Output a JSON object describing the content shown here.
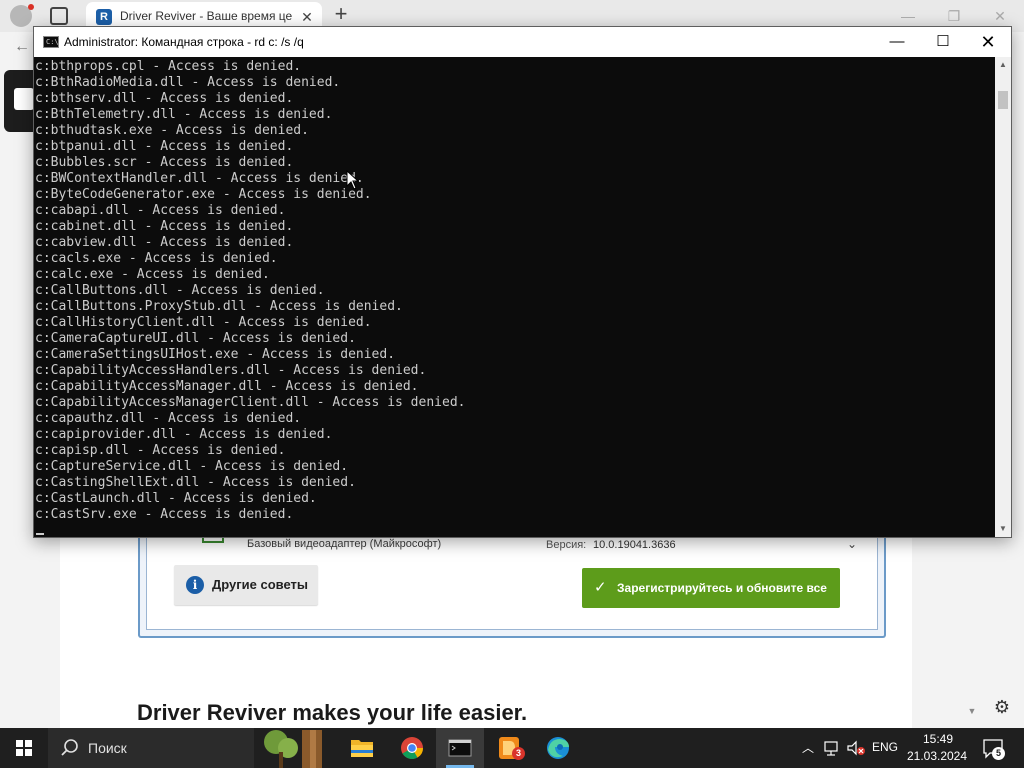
{
  "browser": {
    "tab_title": "Driver Reviver - Ваше время це",
    "tab_favicon_letter": "R"
  },
  "page": {
    "device_name": "Базовый видеоадаптер (Майкрософт)",
    "version_label": "Версия:",
    "version_value": "10.0.19041.3636",
    "tips_label": "Другие советы",
    "tips_icon": "i",
    "register_label": "Зарегистрируйтесь и обновите все",
    "heading": "Driver Reviver makes your life easier.",
    "colors": {
      "register": "#5d9c1b",
      "tips_icon": "#1b5ea7",
      "panel_border": "#6b9ac8"
    }
  },
  "console": {
    "title": "Administrator: Командная строка - rd  c: /s /q",
    "lines": [
      "c:bthprops.cpl - Access is denied.",
      "c:BthRadioMedia.dll - Access is denied.",
      "c:bthserv.dll - Access is denied.",
      "c:BthTelemetry.dll - Access is denied.",
      "c:bthudtask.exe - Access is denied.",
      "c:btpanui.dll - Access is denied.",
      "c:Bubbles.scr - Access is denied.",
      "c:BWContextHandler.dll - Access is denied.",
      "c:ByteCodeGenerator.exe - Access is denied.",
      "c:cabapi.dll - Access is denied.",
      "c:cabinet.dll - Access is denied.",
      "c:cabview.dll - Access is denied.",
      "c:cacls.exe - Access is denied.",
      "c:calc.exe - Access is denied.",
      "c:CallButtons.dll - Access is denied.",
      "c:CallButtons.ProxyStub.dll - Access is denied.",
      "c:CallHistoryClient.dll - Access is denied.",
      "c:CameraCaptureUI.dll - Access is denied.",
      "c:CameraSettingsUIHost.exe - Access is denied.",
      "c:CapabilityAccessHandlers.dll - Access is denied.",
      "c:CapabilityAccessManager.dll - Access is denied.",
      "c:CapabilityAccessManagerClient.dll - Access is denied.",
      "c:capauthz.dll - Access is denied.",
      "c:capiprovider.dll - Access is denied.",
      "c:capisp.dll - Access is denied.",
      "c:CaptureService.dll - Access is denied.",
      "c:CastingShellExt.dll - Access is denied.",
      "c:CastLaunch.dll - Access is denied.",
      "c:CastSrv.exe - Access is denied."
    ],
    "colors": {
      "background": "#0c0c0c",
      "text": "#cccccc"
    }
  },
  "taskbar": {
    "search_label": "Поиск",
    "language": "ENG",
    "time": "15:49",
    "date": "21.03.2024",
    "notification_count": "5",
    "driver_badge": "3",
    "apps": [
      "file-explorer",
      "chrome",
      "command-prompt",
      "driver-reviver",
      "edge"
    ]
  }
}
